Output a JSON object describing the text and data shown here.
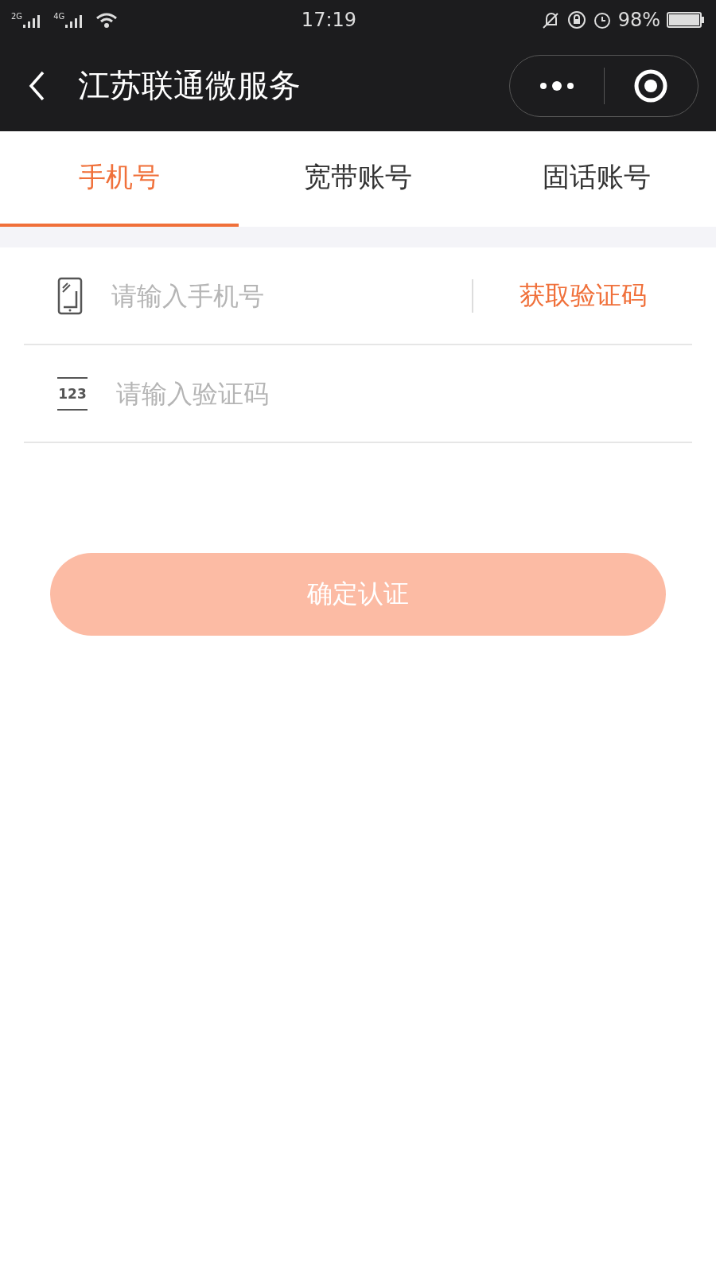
{
  "status_bar": {
    "signal_1": "2G",
    "signal_2": "4G",
    "time": "17:19",
    "battery": "98%"
  },
  "nav_bar": {
    "title": "江苏联通微服务"
  },
  "tabs": [
    {
      "label": "手机号",
      "selected": true
    },
    {
      "label": "宽带账号",
      "selected": false
    },
    {
      "label": "固话账号",
      "selected": false
    }
  ],
  "form": {
    "fields": [
      {
        "kind": "phone",
        "placeholder": "请输入手机号",
        "action": "获取验证码"
      },
      {
        "kind": "code",
        "icon_text": "123",
        "placeholder": "请输入验证码"
      }
    ]
  },
  "submit_button": {
    "label": "确定认证",
    "disabled": true
  }
}
